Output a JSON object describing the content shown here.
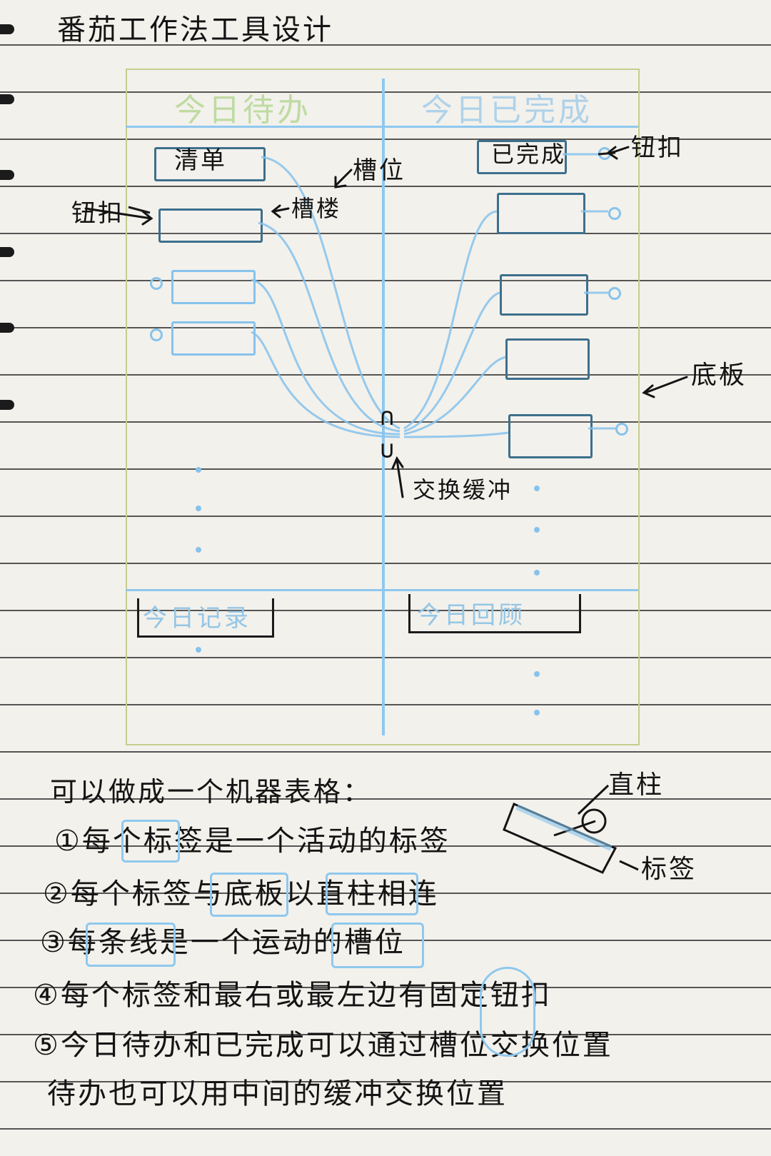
{
  "title": "番茄工作法工具设计",
  "board": {
    "tab_todo": "今日待办",
    "tab_done": "今日已完成",
    "card_list": "清单",
    "card_done": "已完成",
    "bin_record": "今日记录",
    "bin_review": "今日回顾",
    "buffer_top": "∩",
    "buffer_bottom": "∪"
  },
  "annotations": {
    "button_right": "钮扣",
    "button_left": "钮扣",
    "slot": "槽位",
    "slot_struck": "槽楼",
    "board": "底板",
    "swap_buffer": "交换缓冲",
    "pillar": "直柱",
    "label": "标签"
  },
  "notes": {
    "intro": "可以做成一个机器表格：",
    "items": [
      "①每个标签是一个活动的标签",
      "②每个标签与底板以直柱相连",
      "③每条线是一个运动的槽位",
      "④每个标签和最右或最左边有固定钮扣",
      "⑤今日待办和已完成可以通过槽位交换位置",
      "待办也可以用中间的缓冲交换位置"
    ]
  },
  "colors": {
    "ink": "#141414",
    "blue_pencil": "#86c3ec",
    "green_pencil": "#c7cc8f",
    "paper": "#f3f1ec"
  }
}
